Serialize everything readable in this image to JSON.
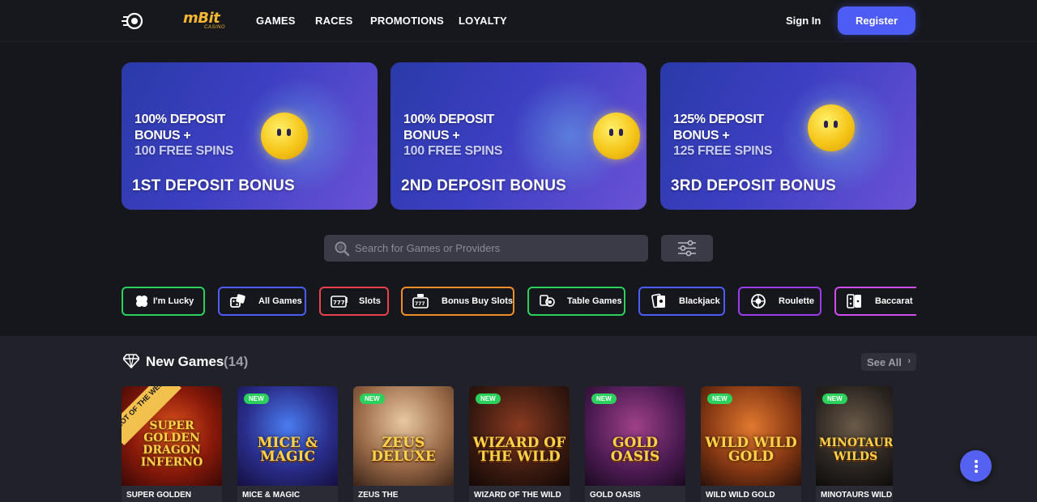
{
  "header": {
    "logo_text": "mBit",
    "logo_sub": "CASINO",
    "nav": [
      "GAMES",
      "RACES",
      "PROMOTIONS",
      "LOYALTY"
    ],
    "signin_label": "Sign In",
    "register_label": "Register"
  },
  "promos": [
    {
      "line1": "100% DEPOSIT",
      "line2": "BONUS +",
      "line3": "100 FREE SPINS",
      "title": "1ST DEPOSIT BONUS"
    },
    {
      "line1": "100% DEPOSIT",
      "line2": "BONUS +",
      "line3": "100 FREE SPINS",
      "title": "2ND DEPOSIT BONUS"
    },
    {
      "line1": "125% DEPOSIT",
      "line2": "BONUS +",
      "line3": "125 FREE SPINS",
      "title": "3RD DEPOSIT BONUS"
    }
  ],
  "search": {
    "placeholder": "Search for Games or Providers",
    "icon": "search-icon"
  },
  "categories": [
    {
      "label": "I'm Lucky",
      "color": "#2bd15c",
      "icon": "clover-icon"
    },
    {
      "label": "All Games",
      "color": "#4d5cf5",
      "icon": "dice-icon"
    },
    {
      "label": "Slots",
      "color": "#e8434d",
      "icon": "slot-777-icon"
    },
    {
      "label": "Bonus Buy Slots",
      "color": "#f28c28",
      "icon": "bonus-buy-slot-icon"
    },
    {
      "label": "Table Games",
      "color": "#2bd15c",
      "icon": "table-games-icon"
    },
    {
      "label": "Blackjack",
      "color": "#4d5cf5",
      "icon": "cards-icon"
    },
    {
      "label": "Roulette",
      "color": "#9c3cf0",
      "icon": "roulette-icon"
    },
    {
      "label": "Baccarat",
      "color": "#d14cf0",
      "icon": "baccarat-icon"
    }
  ],
  "section": {
    "title": "New Games",
    "count": "(14)",
    "see_all": "See All",
    "icon": "diamond-icon"
  },
  "games": [
    {
      "name": "SUPER GOLDEN",
      "art": "SUPER GOLDEN DRAGON INFERNO",
      "ribbon": "SLOT OF THE WEEK",
      "badge": ""
    },
    {
      "name": "MICE & MAGIC",
      "art": "MICE & MAGIC",
      "ribbon": "",
      "badge": "NEW"
    },
    {
      "name": "ZEUS THE",
      "art": "ZEUS DELUXE",
      "ribbon": "",
      "badge": "NEW"
    },
    {
      "name": "WIZARD OF THE WILD",
      "art": "WIZARD OF THE WILD",
      "ribbon": "",
      "badge": "NEW"
    },
    {
      "name": "GOLD OASIS",
      "art": "GOLD OASIS",
      "ribbon": "",
      "badge": "NEW"
    },
    {
      "name": "WILD WILD GOLD",
      "art": "WILD WILD GOLD",
      "ribbon": "",
      "badge": "NEW"
    },
    {
      "name": "MINOTAURS WILD",
      "art": "MINOTAURS WILDS",
      "ribbon": "",
      "badge": "NEW"
    }
  ],
  "colors": {
    "accent": "#4d5cf5",
    "new_badge": "#2bd15c",
    "background": "#16171d"
  }
}
